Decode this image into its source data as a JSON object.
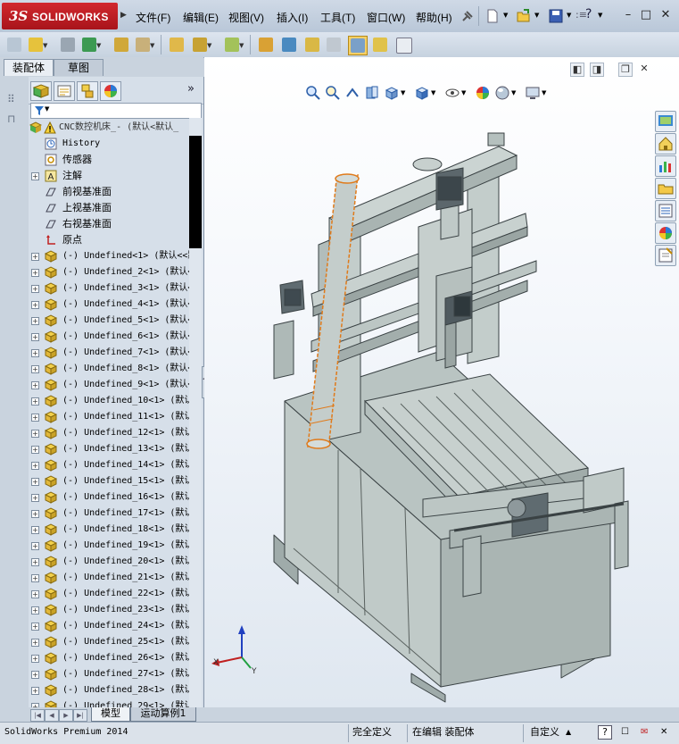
{
  "app": {
    "logo_ds": "3S",
    "logo_text": "SOLIDWORKS",
    "menus": [
      "文件(F)",
      "编辑(E)",
      "视图(V)",
      "插入(I)",
      "工具(T)",
      "窗口(W)",
      "帮助(H)"
    ],
    "help_mark": "?"
  },
  "command_tabs": [
    "装配体",
    "草图"
  ],
  "tree": {
    "root": "CNC数控机床_-  (默认<默认_",
    "fixed_items": [
      {
        "label": "History",
        "icon": "history-icon"
      },
      {
        "label": "传感器",
        "icon": "sensor-icon"
      },
      {
        "label": "注解",
        "icon": "annotation-icon"
      },
      {
        "label": "前视基准面",
        "icon": "plane-icon"
      },
      {
        "label": "上视基准面",
        "icon": "plane-icon"
      },
      {
        "label": "右视基准面",
        "icon": "plane-icon"
      },
      {
        "label": "原点",
        "icon": "origin-icon"
      }
    ],
    "components": [
      "(-) Undefined<1> (默认<<默",
      "(-) Undefined_2<1> (默认<<",
      "(-) Undefined_3<1> (默认<<",
      "(-) Undefined_4<1> (默认<<",
      "(-) Undefined_5<1> (默认<<",
      "(-) Undefined_6<1> (默认<<",
      "(-) Undefined_7<1> (默认<<",
      "(-) Undefined_8<1> (默认<<",
      "(-) Undefined_9<1> (默认<<",
      "(-) Undefined_10<1> (默认<",
      "(-) Undefined_11<1> (默认<",
      "(-) Undefined_12<1> (默认<",
      "(-) Undefined_13<1> (默认<",
      "(-) Undefined_14<1> (默认<",
      "(-) Undefined_15<1> (默认<",
      "(-) Undefined_16<1> (默认<",
      "(-) Undefined_17<1> (默认<",
      "(-) Undefined_18<1> (默认<",
      "(-) Undefined_19<1> (默认<",
      "(-) Undefined_20<1> (默认<",
      "(-) Undefined_21<1> (默认<",
      "(-) Undefined_22<1> (默认<",
      "(-) Undefined_23<1> (默认<",
      "(-) Undefined_24<1> (默认<",
      "(-) Undefined_25<1> (默认<",
      "(-) Undefined_26<1> (默认<",
      "(-) Undefined_27<1> (默认<",
      "(-) Undefined_28<1> (默认<",
      "(-) Undefined_29<1> (默认<"
    ]
  },
  "bottom_tabs": [
    "模型",
    "运动算例1"
  ],
  "status": {
    "product": "SolidWorks Premium 2014",
    "definition": "完全定义",
    "editing": "在编辑 装配体",
    "units": "自定义",
    "help": "?"
  },
  "colors": {
    "part_fill": "#b7c2c0",
    "part_edge": "#3a4244",
    "selection": "#e07a1a",
    "logo_red": "#c0202a"
  }
}
